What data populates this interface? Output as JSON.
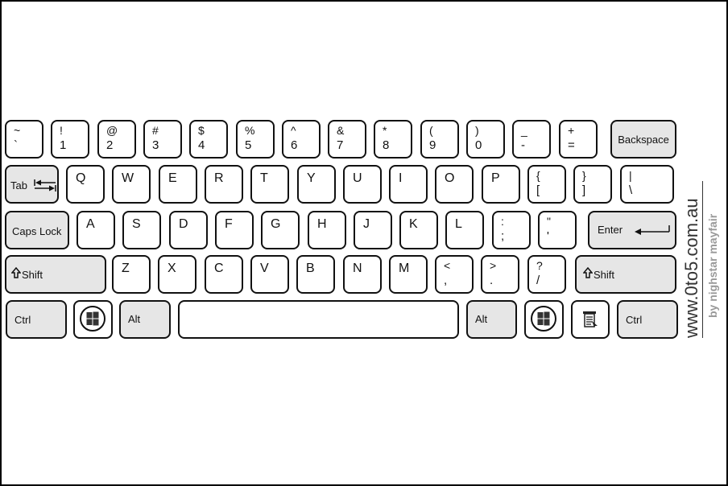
{
  "keyboard": {
    "row1": [
      {
        "top": "~",
        "bottom": "`"
      },
      {
        "top": "!",
        "bottom": "1"
      },
      {
        "top": "@",
        "bottom": "2"
      },
      {
        "top": "#",
        "bottom": "3"
      },
      {
        "top": "$",
        "bottom": "4"
      },
      {
        "top": "%",
        "bottom": "5"
      },
      {
        "top": "^",
        "bottom": "6"
      },
      {
        "top": "&",
        "bottom": "7"
      },
      {
        "top": "*",
        "bottom": "8"
      },
      {
        "top": "(",
        "bottom": "9"
      },
      {
        "top": ")",
        "bottom": "0"
      },
      {
        "top": "_",
        "bottom": "-"
      },
      {
        "top": "+",
        "bottom": "="
      }
    ],
    "backspace": "Backspace",
    "tab": "Tab",
    "row2": [
      "Q",
      "W",
      "E",
      "R",
      "T",
      "Y",
      "U",
      "I",
      "O",
      "P"
    ],
    "row2_sym": [
      {
        "top": "{",
        "bottom": "["
      },
      {
        "top": "}",
        "bottom": "]"
      },
      {
        "top": "|",
        "bottom": "\\"
      }
    ],
    "caps_lock": "Caps Lock",
    "row3": [
      "A",
      "S",
      "D",
      "F",
      "G",
      "H",
      "J",
      "K",
      "L"
    ],
    "row3_sym": [
      {
        "top": ":",
        "bottom": ";"
      },
      {
        "top": "\"",
        "bottom": "'"
      }
    ],
    "enter": "Enter",
    "shift_left": "Shift",
    "row4": [
      "Z",
      "X",
      "C",
      "V",
      "B",
      "N",
      "M"
    ],
    "row4_sym": [
      {
        "top": "<",
        "bottom": ","
      },
      {
        "top": ">",
        "bottom": "."
      },
      {
        "top": "?",
        "bottom": "/"
      }
    ],
    "shift_right": "Shift",
    "ctrl_left": "Ctrl",
    "alt_left": "Alt",
    "alt_right": "Alt",
    "ctrl_right": "Ctrl",
    "icons": {
      "windows": "windows-logo-icon",
      "menu": "context-menu-icon",
      "tab_arrow": "tab-arrows-icon",
      "enter_arrow": "enter-arrow-icon",
      "shift_arrow": "shift-arrow-icon"
    }
  },
  "branding": {
    "site": "www.0to5.com.au",
    "author": "by nighstar mayfair"
  }
}
